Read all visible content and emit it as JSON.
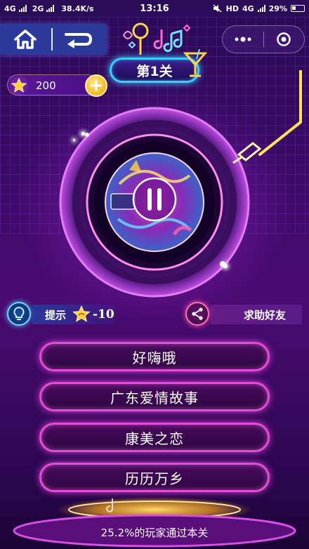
{
  "status_bar": {
    "network_1": "4G",
    "network_2": "2G",
    "speed": "38.4K/s",
    "time": "13:16",
    "hd": "HD",
    "network_3": "4G",
    "battery": "29%"
  },
  "level": {
    "title": "第1关"
  },
  "coins": {
    "value": "200",
    "add_label": "+"
  },
  "disc": {
    "state": "paused"
  },
  "hint": {
    "label": "提示",
    "cost": "-10"
  },
  "help": {
    "label": "求助好友"
  },
  "options": [
    {
      "label": "好嗨哦"
    },
    {
      "label": "广东爱情故事"
    },
    {
      "label": "康美之恋"
    },
    {
      "label": "历历万乡"
    }
  ],
  "footer": {
    "pass_rate_text": "25.2%的玩家通过本关"
  },
  "colors": {
    "option_border": "#e24cd6",
    "level_border": "#39d0ff",
    "coin_gold": "#f1a500"
  }
}
